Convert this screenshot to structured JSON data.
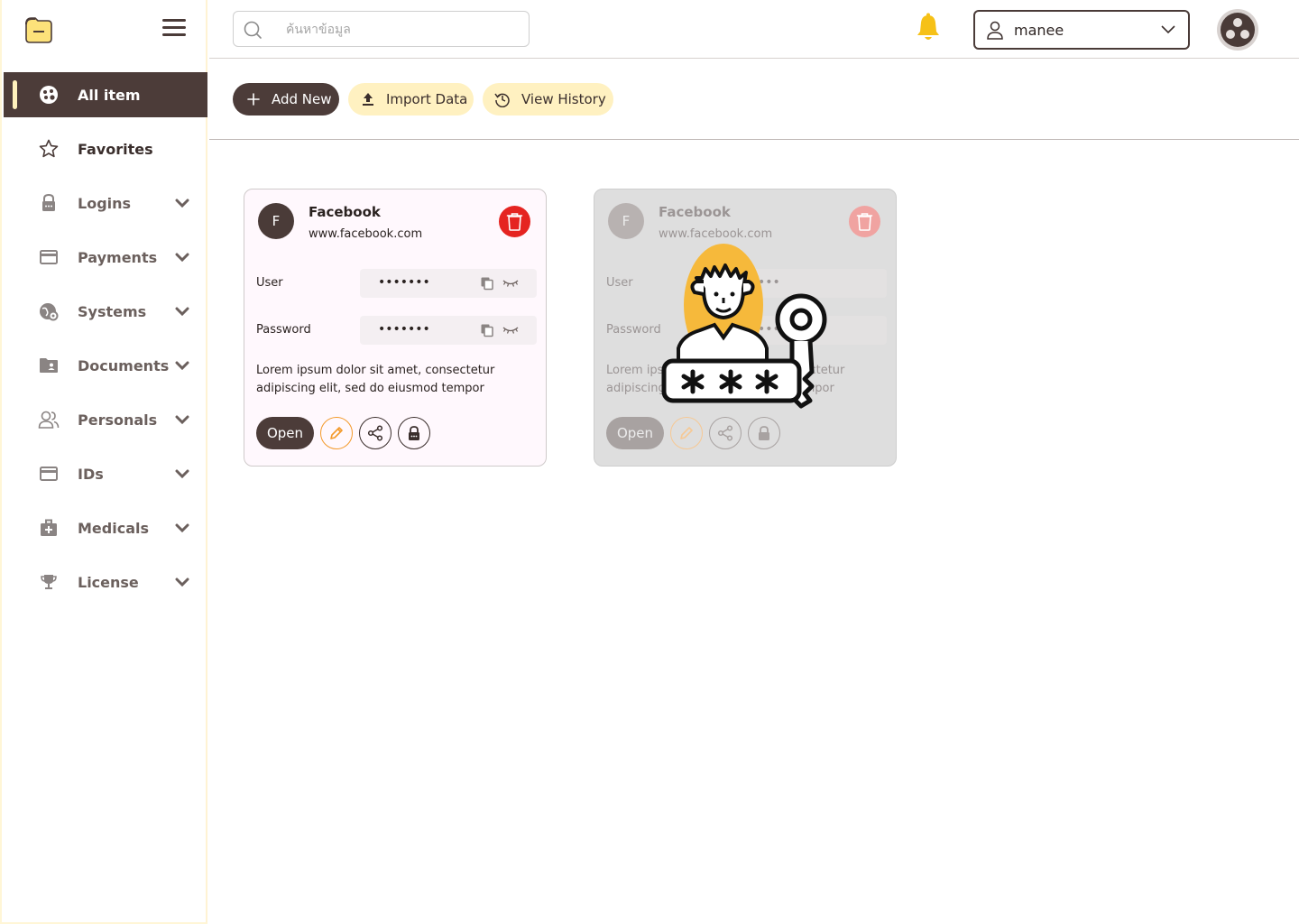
{
  "sidebar": {
    "logo_icon": "folder-logo-icon",
    "menu_icon": "hamburger-icon",
    "items": [
      {
        "label": "All item",
        "icon": "palette-icon",
        "active": true
      },
      {
        "label": "Favorites",
        "icon": "star-icon"
      },
      {
        "label": "Logins",
        "icon": "lock-icon"
      },
      {
        "label": "Payments",
        "icon": "credit-card-icon"
      },
      {
        "label": "Systems",
        "icon": "globe-gear-icon"
      },
      {
        "label": "Documents",
        "icon": "folder-user-icon"
      },
      {
        "label": "Personals",
        "icon": "people-icon"
      },
      {
        "label": "IDs",
        "icon": "id-card-icon"
      },
      {
        "label": "Medicals",
        "icon": "medical-kit-icon"
      },
      {
        "label": "License",
        "icon": "trophy-icon"
      }
    ]
  },
  "header": {
    "search_placeholder": "ค้นหาข้อมูล",
    "search_value": "",
    "user_name": "manee",
    "notification_icon": "bell-icon",
    "avatar_icon": "avatar-icon"
  },
  "toolbar": {
    "add_label": "Add New",
    "import_label": "Import Data",
    "history_label": "View History"
  },
  "cards": [
    {
      "initial": "F",
      "title": "Facebook",
      "url": "www.facebook.com",
      "user_label": "User",
      "user_value": "•••••••",
      "password_label": "Password",
      "password_value": "•••••••",
      "description": "Lorem ipsum dolor sit amet, consectetur adipiscing elit, sed do eiusmod tempor",
      "open_label": "Open"
    },
    {
      "initial": "F",
      "title": "Facebook",
      "url": "www.facebook.com",
      "user_label": "User",
      "user_value": "•••••••",
      "password_label": "Password",
      "password_value": "•••••••",
      "description": "Lorem ipsum dolor sit amet, consectetur adipiscing elit, sed do eiusmod tempor",
      "open_label": "Open"
    }
  ],
  "colors": {
    "primary": "#4c3c39",
    "accent_yellow": "#fff1c1",
    "bell": "#f6c117",
    "danger": "#e52421",
    "edit": "#f39a2b"
  }
}
